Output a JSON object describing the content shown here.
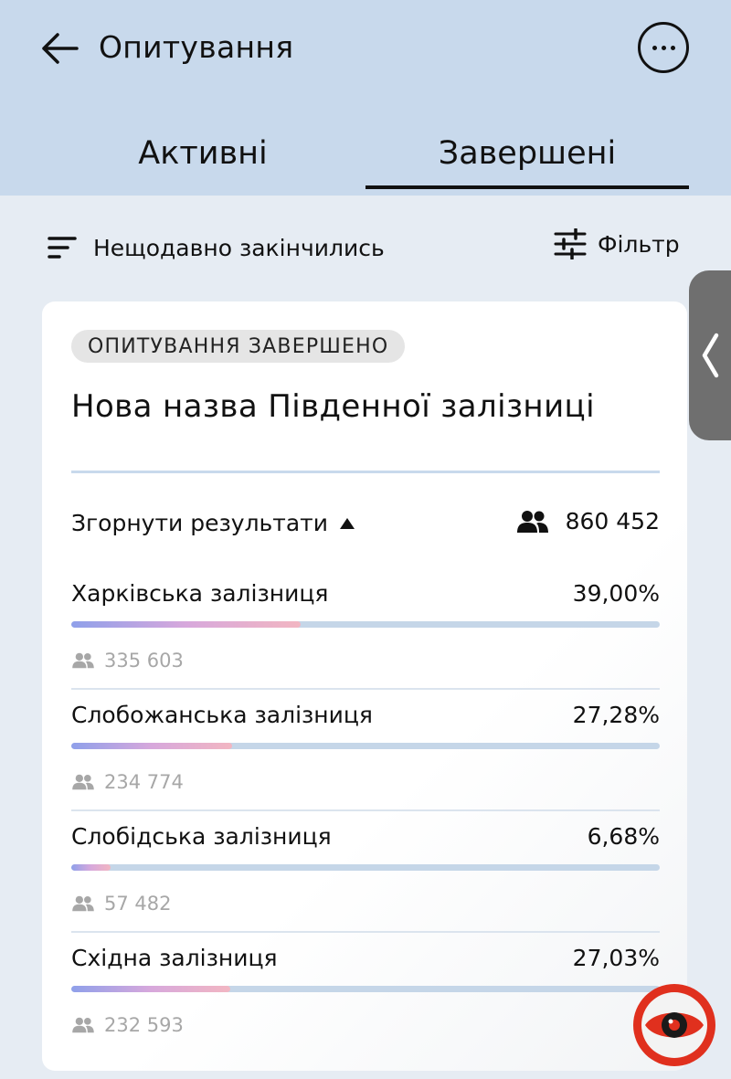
{
  "header": {
    "title": "Опитування",
    "tabs": [
      {
        "label": "Активні",
        "selected": false
      },
      {
        "label": "Завершені",
        "selected": true
      }
    ]
  },
  "toolbar": {
    "sort_label": "Нещодавно закінчились",
    "filter_label": "Фільтр"
  },
  "card": {
    "status": "ОПИТУВАННЯ ЗАВЕРШЕНО",
    "title": "Нова назва Південної залізниці",
    "collapse_label": "Згорнути результати",
    "total_votes": "860 452",
    "options": [
      {
        "label": "Харківська залізниця",
        "percent": "39,00%",
        "share": 39.0,
        "votes": "335 603"
      },
      {
        "label": "Слобожанська залізниця",
        "percent": "27,28%",
        "share": 27.28,
        "votes": "234 774"
      },
      {
        "label": "Слобідська залізниця",
        "percent": "6,68%",
        "share": 6.68,
        "votes": "57 482"
      },
      {
        "label": "Східна залізниця",
        "percent": "27,03%",
        "share": 27.03,
        "votes": "232 593"
      }
    ]
  },
  "icons": {
    "back": "arrow-left-icon",
    "more": "more-horizontal-icon",
    "sort": "sort-lines-icon",
    "filter": "sliders-icon",
    "people": "people-icon",
    "collapse": "triangle-up-icon",
    "handle": "chevron-left-icon",
    "watermark": "eye-icon"
  },
  "colors": {
    "header_bg": "#c8d9ec",
    "page_bg": "#e6ecf3",
    "bar_track": "#c5d6e8",
    "bar_gradient": [
      "#8fa0ea",
      "#d7a8dc",
      "#f2b6c2"
    ],
    "watermark_red": "#e0301e"
  }
}
